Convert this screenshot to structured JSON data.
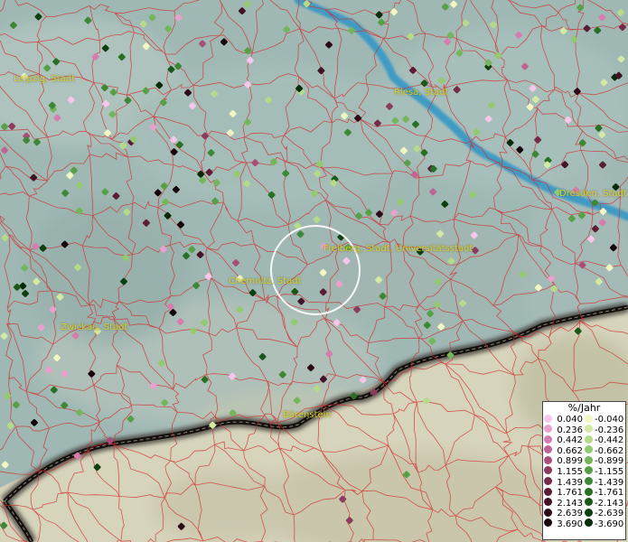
{
  "map": {
    "cities": [
      {
        "id": "leipzig",
        "label": "Leipzig, Stadt"
      },
      {
        "id": "riesa",
        "label": "Riesa, Stadt"
      },
      {
        "id": "dresden",
        "label": "Dresden, Stadt"
      },
      {
        "id": "freiberg",
        "label": "Freiberg, Stadt, Universitätsstadt"
      },
      {
        "id": "chemnitz",
        "label": "Chemnitz, Stadt"
      },
      {
        "id": "zwickau",
        "label": "Zwickau, Stadt"
      },
      {
        "id": "baerenstein",
        "label": "Bärenstein"
      }
    ],
    "colors": {
      "water": "#3f9bc4",
      "district_border": "#d42a2a",
      "city_label": "#d8cf2a",
      "state_border": "#1a1412"
    }
  },
  "legend": {
    "title": "%/Jahr",
    "rows": [
      {
        "pos": "0.040",
        "pos_color": "#f7c6ea",
        "neg": "-0.040",
        "neg_color": "#f0f7c0"
      },
      {
        "pos": "0.236",
        "pos_color": "#e9a0cc",
        "neg": "-0.236",
        "neg_color": "#d3eaa4"
      },
      {
        "pos": "0.442",
        "pos_color": "#d67cae",
        "neg": "-0.442",
        "neg_color": "#b4dc88"
      },
      {
        "pos": "0.662",
        "pos_color": "#c06593",
        "neg": "-0.662",
        "neg_color": "#94ca6e"
      },
      {
        "pos": "0.899",
        "pos_color": "#a84e78",
        "neg": "-0.899",
        "neg_color": "#74b65a"
      },
      {
        "pos": "1.155",
        "pos_color": "#8e3a5e",
        "neg": "-1.155",
        "neg_color": "#56a046"
      },
      {
        "pos": "1.439",
        "pos_color": "#762a4a",
        "neg": "-1.439",
        "neg_color": "#3c8834"
      },
      {
        "pos": "1.761",
        "pos_color": "#5c1c36",
        "neg": "-1.761",
        "neg_color": "#287024"
      },
      {
        "pos": "2.143",
        "pos_color": "#431226",
        "neg": "-2.143",
        "neg_color": "#185818"
      },
      {
        "pos": "2.639",
        "pos_color": "#2c0a18",
        "neg": "-2.639",
        "neg_color": "#0c400e"
      },
      {
        "pos": "3.690",
        "pos_color": "#14040a",
        "neg": "-3.690",
        "neg_color": "#042a06"
      }
    ]
  }
}
